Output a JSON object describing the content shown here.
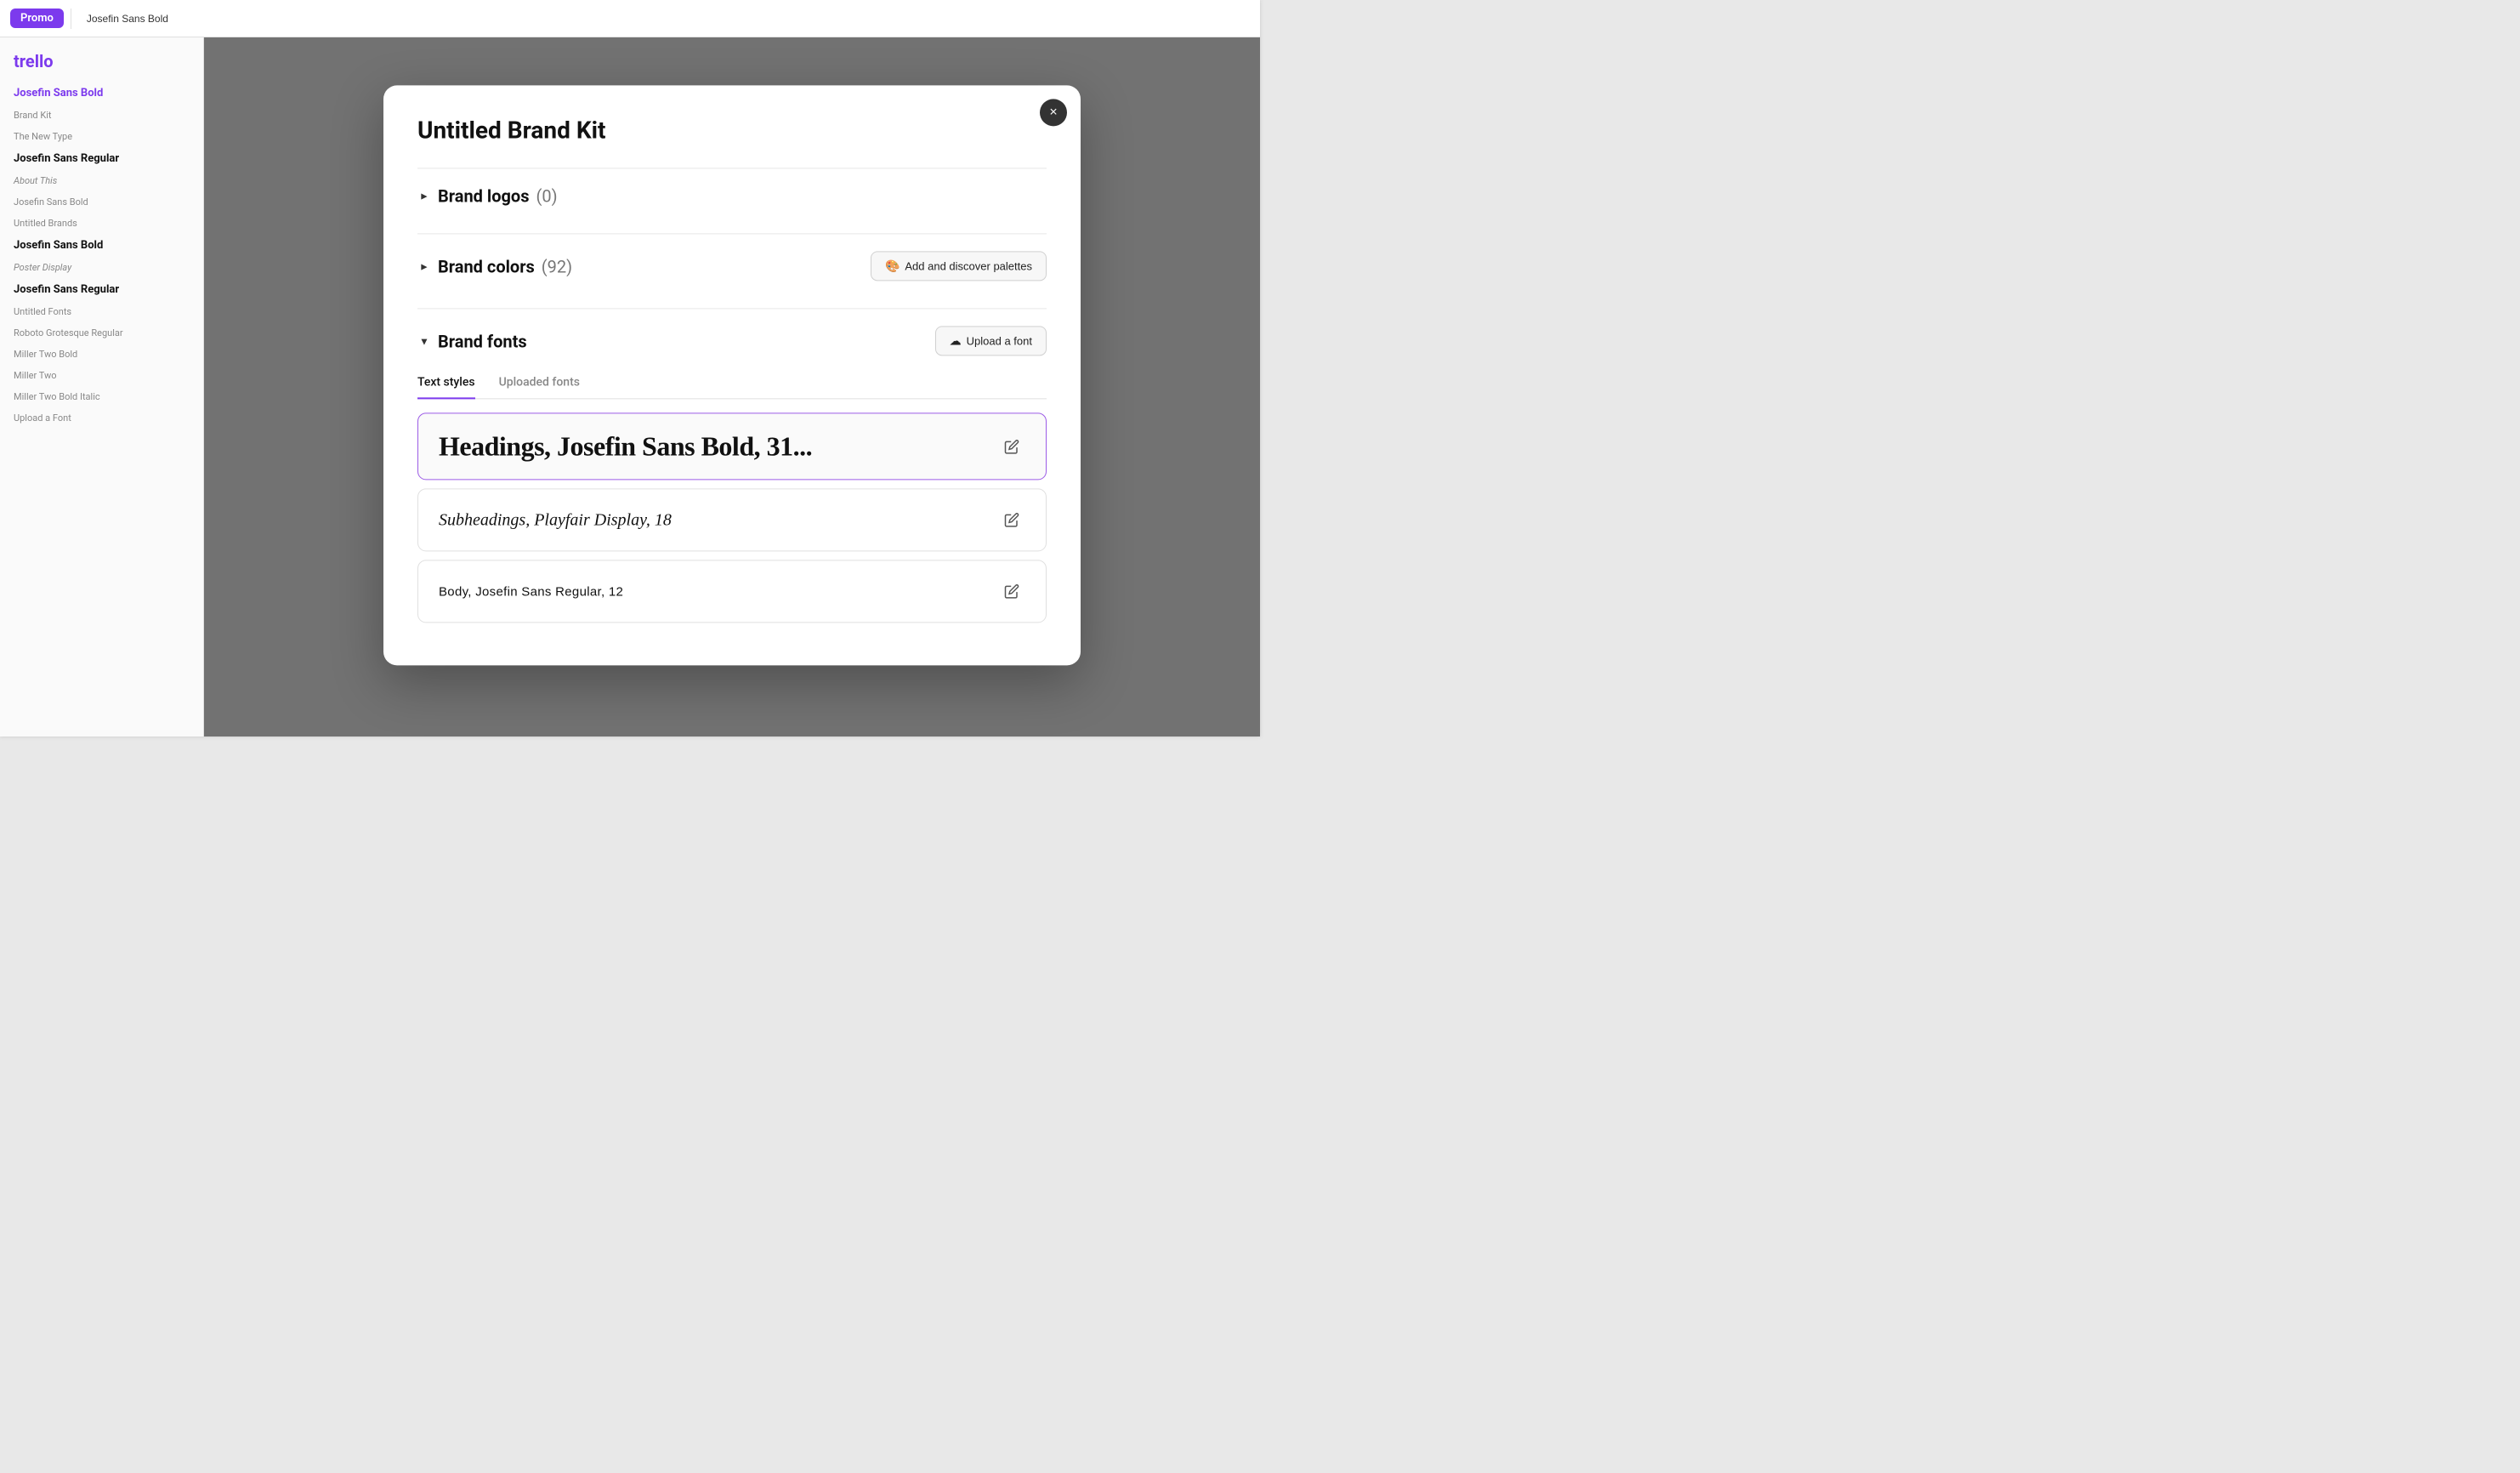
{
  "app": {
    "title": "Trello",
    "toolbar_title": "Promo",
    "active_file": "Josefin Sans Bold"
  },
  "sidebar": {
    "logo": "trello",
    "items": [
      {
        "label": "Josefin Sans Bold",
        "type": "active"
      },
      {
        "label": "Brand Kit",
        "type": "small"
      },
      {
        "label": "The New Type",
        "type": "small"
      },
      {
        "label": "Josefin Sans Regular",
        "type": "bold"
      },
      {
        "label": "About This",
        "type": "small"
      },
      {
        "label": "Josefin Sans Bold",
        "type": "small"
      },
      {
        "label": "Untitled Brands",
        "type": "small"
      },
      {
        "label": "Josefin Sans Bold",
        "type": "bold"
      },
      {
        "label": "Poster Display",
        "type": "italic"
      },
      {
        "label": "Josefin Sans Regular",
        "type": "bold"
      },
      {
        "label": "Untitled Fonts",
        "type": "small"
      },
      {
        "label": "Roboto Grotesque Regular",
        "type": "small"
      },
      {
        "label": "Miller Two Bold",
        "type": "small"
      },
      {
        "label": "Miller Two",
        "type": "small"
      },
      {
        "label": "Miller Two Bold Italic",
        "type": "small"
      },
      {
        "label": "Upload a Font",
        "type": "small"
      }
    ]
  },
  "modal": {
    "title": "Untitled Brand Kit",
    "close_label": "×",
    "sections": {
      "logos": {
        "title": "Brand logos",
        "count": "(0)",
        "collapsed": true
      },
      "colors": {
        "title": "Brand colors",
        "count": "(92)",
        "collapsed": true,
        "action_label": "Add and discover palettes",
        "action_icon": "palette-icon"
      },
      "fonts": {
        "title": "Brand fonts",
        "collapsed": false,
        "action_label": "Upload a font",
        "action_icon": "upload-icon",
        "tabs": [
          {
            "label": "Text styles",
            "active": true
          },
          {
            "label": "Uploaded fonts",
            "active": false
          }
        ],
        "text_styles": [
          {
            "label": "Headings, Josefin Sans Bold, 31...",
            "style": "heading",
            "active": true
          },
          {
            "label": "Subheadings, Playfair Display, 18",
            "style": "subheading",
            "active": false
          },
          {
            "label": "Body, Josefin Sans Regular, 12",
            "style": "body",
            "active": false
          }
        ]
      }
    }
  }
}
